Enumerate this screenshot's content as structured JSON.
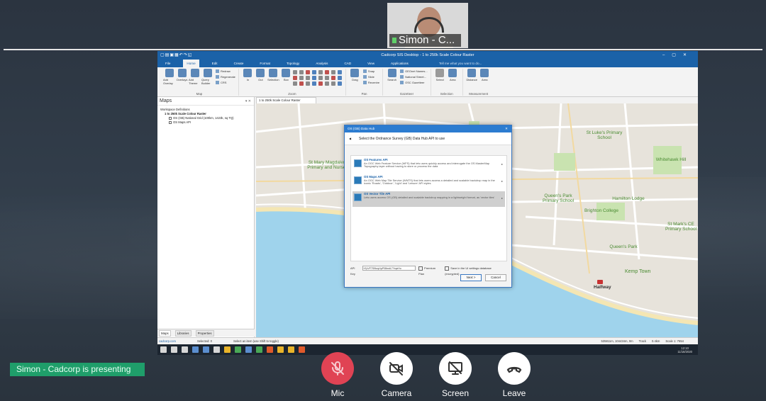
{
  "meeting": {
    "presenter_camera_label": "Simon - C...",
    "presenting_banner": "Simon - Cadcorp is presenting",
    "controls": [
      {
        "label": "Mic",
        "icon": "mic-muted-icon",
        "state": "muted"
      },
      {
        "label": "Camera",
        "icon": "camera-off-icon",
        "state": "off"
      },
      {
        "label": "Screen",
        "icon": "screen-share-off-icon",
        "state": "off"
      },
      {
        "label": "Leave",
        "icon": "phone-hangup-icon",
        "state": "default"
      }
    ],
    "colors": {
      "presenting_banner": "#1f9e6a",
      "mic_muted": "#e04354"
    }
  },
  "app": {
    "title": "Cadcorp SIS Desktop - 1 to 250k Scale Colour Raster",
    "menu": [
      "File",
      "Home",
      "Edit",
      "Create",
      "Format",
      "Topology",
      "Analysis",
      "CAD",
      "View",
      "Applications"
    ],
    "active_menu": "Home",
    "tell_me": "Tell me what you want to do...",
    "ribbon": {
      "map": {
        "label": "Map",
        "big": [
          "Add Overlay",
          "Overlays",
          "Add Theme",
          "Query Builder"
        ],
        "small": [
          "Redraw",
          "Regenerate",
          "CRS"
        ]
      },
      "zoom": {
        "label": "Zoom",
        "big": [
          "In",
          "Out",
          "Selection",
          "Box"
        ]
      },
      "pan": {
        "label": "Pan",
        "big": [
          "Drag"
        ],
        "small": [
          "Snap",
          "Slide",
          "Recentre"
        ]
      },
      "gazetteer": {
        "label": "Gazetteer",
        "big": [
          "Search"
        ],
        "small": [
          "GEOnet Names...",
          "National Street...",
          "OSC Gazetteer"
        ]
      },
      "selection": {
        "label": "Selection",
        "big": [
          "Select",
          "Area"
        ]
      },
      "measurement": {
        "label": "Measurement",
        "big": [
          "Distance",
          "Area"
        ]
      }
    },
    "maps_panel": {
      "title": "Maps",
      "tree": {
        "root": "Workspace Definitions",
        "map": "1 to 250k Scale Colour Raster",
        "layers": [
          "OS (GB) National Grid (100km, 1423k, sq TQ)",
          "OS Maps API"
        ]
      },
      "tabs": [
        "Maps",
        "Libraries",
        "Properties"
      ]
    },
    "map_tab": "1 to 250k Scale Colour Raster",
    "map_labels": [
      "St Mary Magdalene Primary and Nursery",
      "St Luke's Primary School",
      "Whitehawk Hill",
      "Queen's Park Primary School",
      "Hamilton Lodge",
      "Brighton College",
      "St Mark's CE Primary School",
      "Queen's Park",
      "Kemp Town",
      "Halfway"
    ],
    "status": {
      "site": "cadcorp.com",
      "selected": "Selected: 0",
      "hint": "Select an item (use Shift to toggle)",
      "coords": "535811m, 104434m, 0m",
      "track": "Track",
      "distance": "0.4km",
      "scale": "Scale 1: 7654"
    },
    "taskbar": {
      "time": "12:10",
      "date": "11/18/2020"
    }
  },
  "dialog": {
    "title": "OS (GB) Data Hub",
    "heading": "Select the Ordnance Survey (GB) Data Hub API to use",
    "options": [
      {
        "name": "OS Features API",
        "description": "An OGC Web Feature Service (WFS) that lets users quickly access and interrogate the OS MasterMap Topography layer without having to store or process the data",
        "selected": false
      },
      {
        "name": "OS Maps API",
        "description": "An OGC Web Map Tile Service (WMTS) that lets users access a detailed and scalable backdrop map in the iconic 'Roads', 'Outdoor', 'Light' and 'Leisure' API styles",
        "selected": false
      },
      {
        "name": "OS Vector Tile API",
        "description": "Lets users access OS (GB) detailed and scalable backdrop mapping in a lightweight format, as 'vector tiles'",
        "selected": true
      }
    ],
    "api_key_label": "API Key",
    "api_key_value": "h7pVF7S9kcyUpP08mdL7YrqeHu",
    "premium_plan": "Premium Plan",
    "save_settings": "Save in the UI settings database (encrypted)",
    "next": "Next >",
    "cancel": "Cancel"
  }
}
